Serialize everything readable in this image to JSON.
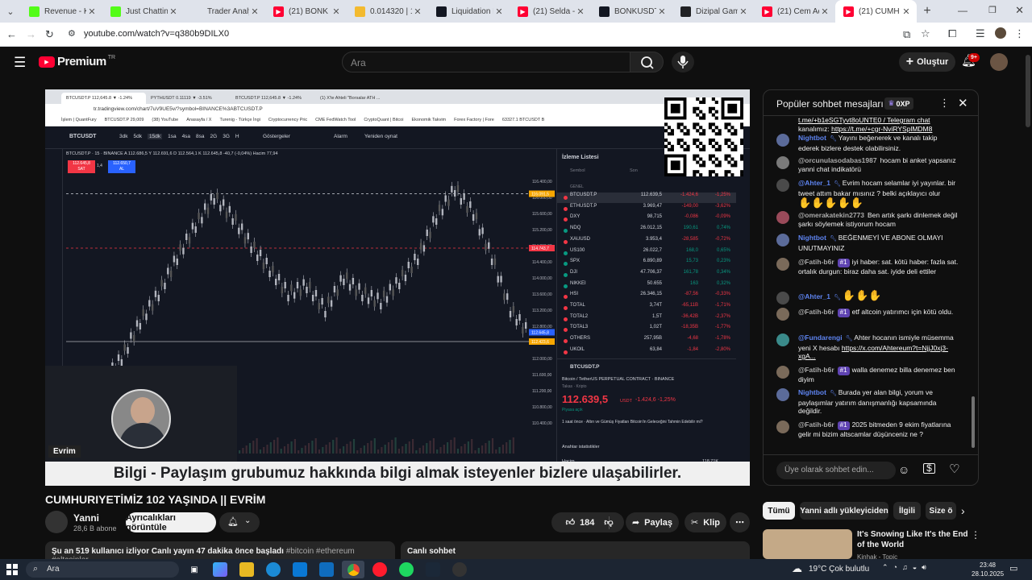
{
  "browser": {
    "tabs": [
      {
        "title": "Revenue - Kick",
        "favicon": "kick-icon",
        "color": "#53fc18",
        "active": false
      },
      {
        "title": "Just Chatting Streams",
        "favicon": "kick-icon",
        "color": "#53fc18",
        "active": false
      },
      {
        "title": "Trader Analysis",
        "favicon": "blank-icon",
        "color": "#dfe3eb",
        "active": false
      },
      {
        "title": "(21) BONK Live",
        "favicon": "youtube-icon",
        "color": "#ff0033",
        "active": false
      },
      {
        "title": "0.014320 | 100",
        "favicon": "coin-icon",
        "color": "#f3ba2f",
        "active": false
      },
      {
        "title": "Liquidation Heatmap",
        "favicon": "tradingview-icon",
        "color": "#131722",
        "active": false
      },
      {
        "title": "(21) Selda - Yo",
        "favicon": "youtube-icon",
        "color": "#ff0033",
        "active": false
      },
      {
        "title": "BONKUSDT 0.0",
        "favicon": "tradingview-icon",
        "color": "#131722",
        "active": false
      },
      {
        "title": "Dizipal Game",
        "favicon": "circle-icon",
        "color": "#202124",
        "active": false
      },
      {
        "title": "(21) Cem Adri",
        "favicon": "youtube-icon",
        "color": "#ff0033",
        "active": false
      },
      {
        "title": "(21) CUMH",
        "favicon": "youtube-icon",
        "color": "#ff0033",
        "active": true
      }
    ],
    "url": "youtube.com/watch?v=q380b9DILX0"
  },
  "yt": {
    "logo_text": "Premium",
    "logo_sup": "TR",
    "search_placeholder": "Ara",
    "create_label": "Oluştur",
    "notif_count": "9+"
  },
  "video": {
    "title": "CUMHURIYETİMİZ 102 YAŞINDA || EVRİM",
    "banner_text": "Bilgi - Paylaşım grubumuz hakkında bilgi almak isteyenler bizlere ulaşabilirler.",
    "cam_label": "Evrim",
    "inner_url": "tr.tradingview.com/chart/7uV9UE5v/?symbol=BINANCE%3ABTCUSDT.P",
    "inner_tabs": [
      "BTCUSDT.P 112,645.8 ▼ -1.24%",
      "PYTHUSDT 0.11119 ▼ -3.51%",
      "BTCUSDT.P 112,645.8 ▼ -1.24%",
      "(1) X'te Ahteli \"Borsalar ATH ..."
    ],
    "bookmarks": [
      "İşlem | QuantFury",
      "BTCUSDT.P 29,009",
      "(38) YouTube",
      "Anasayfa / X",
      "Turenig - Türkçe İngi",
      "Cryptocurrency Pric",
      "CME FedWatch Tool",
      "CryptoQuant | Bitcoi",
      "Ekonomik Takvim",
      "Forex Factory | Fore",
      "63327.1 BTCUSDT B"
    ],
    "symbol": "BTCUSDT",
    "timeframes": [
      "3dk",
      "5dk",
      "15dk",
      "1sa",
      "4sa",
      "8sa",
      "2G",
      "3G",
      "H"
    ],
    "tv_buttons": [
      "Göstergeler",
      "Alarm",
      "Yeniden oynat"
    ],
    "ohlc": "BTCUSDT.P · 15 · BINANCE  A 112.686,5  Y 112.691,6  D 112.564,1  K 112.645,8  -40,7 (-0,04%)  Hacim 77,94",
    "sell_price": "112.645,8",
    "sell_label": "SAT",
    "buy_price": "112.650,7",
    "buy_label": "AL",
    "spread": "1,4",
    "y_ticks": [
      "116.400,00",
      "116.000,00",
      "115.600,00",
      "115.200,00",
      "114.800,00",
      "114.400,00",
      "114.000,00",
      "113.600,00",
      "113.200,00",
      "112.800,00",
      "112.400,00",
      "112.000,00",
      "111.600,00",
      "111.200,00",
      "110.800,00",
      "110.400,00"
    ],
    "price_tags": [
      "116.091,5",
      "114.743,7",
      "112.645,8",
      "112.423,6"
    ],
    "x_ticks": [
      "6:00",
      "12:00",
      "18:00",
      "28",
      "06:00",
      "12:00",
      "18:00",
      "29",
      "06:00",
      "12:00",
      "18:00",
      "30"
    ],
    "time_readout": "23:48:09 (UTC+3)",
    "watchlist_title": "İzleme Listesi",
    "watchlist_headers": [
      "Sembol",
      "Son",
      "Değ",
      "Değ%"
    ],
    "watchlist_group": "GENEL",
    "watchlist": [
      {
        "sym": "BTCUSDT.P",
        "last": "112.639,5",
        "chg": "-1.424,6",
        "pct": "-1,25%"
      },
      {
        "sym": "ETHUSDT.P",
        "last": "3.969,47",
        "chg": "-149,00",
        "pct": "-3,62%"
      },
      {
        "sym": "DXY",
        "last": "98,715",
        "chg": "-0,086",
        "pct": "-0,09%"
      },
      {
        "sym": "NDQ",
        "last": "26.012,15",
        "chg": "190,61",
        "pct": "0,74%"
      },
      {
        "sym": "XAUUSD",
        "last": "3.953,4",
        "chg": "-28,585",
        "pct": "-0,72%"
      },
      {
        "sym": "US100",
        "last": "26.022,7",
        "chg": "168,0",
        "pct": "0,65%"
      },
      {
        "sym": "SPX",
        "last": "6.890,89",
        "chg": "15,73",
        "pct": "0,23%"
      },
      {
        "sym": "DJI",
        "last": "47.706,37",
        "chg": "161,78",
        "pct": "0,34%"
      },
      {
        "sym": "NIKKEI",
        "last": "50.655",
        "chg": "163",
        "pct": "0,32%"
      },
      {
        "sym": "HSI",
        "last": "26.346,15",
        "chg": "-87,56",
        "pct": "-0,33%"
      },
      {
        "sym": "TOTAL",
        "last": "3,74T",
        "chg": "-65,11B",
        "pct": "-1,71%"
      },
      {
        "sym": "TOTAL2",
        "last": "1,5T",
        "chg": "-36,42B",
        "pct": "-2,37%"
      },
      {
        "sym": "TOTAL3",
        "last": "1,02T",
        "chg": "-18,35B",
        "pct": "-1,77%"
      },
      {
        "sym": "OTHERS",
        "last": "257,95B",
        "chg": "-4,68",
        "pct": "-1,78%"
      },
      {
        "sym": "UKOIL",
        "last": "63,84",
        "chg": "-1,84",
        "pct": "-2,80%"
      }
    ],
    "detail_sym": "BTCUSDT.P",
    "detail_desc": "Bitcoin / TetherUS PERPETUAL CONTRACT · BINANCE",
    "detail_type": "Takas · Kripto",
    "detail_price": "112.639,5",
    "detail_ccy": "USDT",
    "detail_chg": "-1.424,6  -1,25%",
    "detail_status": "Piyasa açık",
    "detail_news": "1 saat önce · Altın ve Gümüş Fiyatları Bitcoin'in Geleceğini Tahmin Edebilir mi?",
    "detail_keystats": "Anahtar istatistikler",
    "detail_vol_label": "Hacim",
    "detail_vol": "118,71K"
  },
  "channel": {
    "name": "Yanni",
    "subs": "28,6 B abone",
    "join_label": "Ayrıcalıkları görüntüle"
  },
  "actions": {
    "likes": "184",
    "share": "Paylaş",
    "clip": "Klip"
  },
  "desc": {
    "stats": "Şu an 519 kullanıcı izliyor  Canlı yayın 47 dakika önce başladı",
    "tags": "#bitcoin #ethereum #altcoinler",
    "chat_label": "Canlı sohbet"
  },
  "chat": {
    "header": "Popüler sohbet mesajları",
    "xp": "0XP",
    "input_placeholder": "Üye olarak sohbet edin...",
    "messages": [
      {
        "user": "",
        "text": "kanalımız: ",
        "link": "https://t.me/+cgr-NviRYSplMDM8",
        "pre_link": "t.me/+b1eSGTyvt8oUNTE0 / Telegram chat",
        "mod": false,
        "member": "",
        "hands": 0
      },
      {
        "user": "Nightbot",
        "text": "Yayını beğenerek ve kanalı takip ederek bizlere destek olabilirsiniz.",
        "link": "",
        "pre_link": "",
        "mod": true,
        "member": "",
        "hands": 0
      },
      {
        "user": "@orcunulasodabas1987",
        "text": "hocam bi anket yapsanız yanni chat indikatörü",
        "link": "",
        "pre_link": "",
        "mod": false,
        "member": "",
        "hands": 0
      },
      {
        "user": "@Ahter_1",
        "text": "Evrim hocam selamlar iyi yayınlar. bir tweet attım bakar mısınız ? belki açıklayıcı olur",
        "link": "",
        "pre_link": "",
        "mod": true,
        "member": "",
        "hands": 5
      },
      {
        "user": "@omerakatekin2773",
        "text": "Ben artık şarkı dinlemek değil şarkı söylemek istiyorum hocam",
        "link": "",
        "pre_link": "",
        "mod": false,
        "member": "",
        "hands": 0
      },
      {
        "user": "Nightbot",
        "text": "BEĞENMEYİ VE ABONE OLMAYI UNUTMAYINIZ",
        "link": "",
        "pre_link": "",
        "mod": true,
        "member": "",
        "hands": 0
      },
      {
        "user": "@Fatih-b6r",
        "text": "iyi haber: sat. kötü haber: fazla sat. ortalık durgun: biraz daha sat. iyide deli ettiler",
        "link": "",
        "pre_link": "",
        "mod": false,
        "member": "#1",
        "hands": 0
      },
      {
        "user": "@Ahter_1",
        "text": "",
        "link": "",
        "pre_link": "",
        "mod": true,
        "member": "",
        "hands": 3
      },
      {
        "user": "@Fatih-b6r",
        "text": "etf altcoin yatırımcı için kötü oldu.",
        "link": "",
        "pre_link": "",
        "mod": false,
        "member": "#1",
        "hands": 0
      },
      {
        "user": "@Fundarengi",
        "text": "Ahter hocanın ismiyle müsemma yeni X hesabı ",
        "link": "https://x.com/Ahtereum?t=NjjJ0xj3-xgA...",
        "pre_link": "",
        "mod": true,
        "member": "",
        "hands": 0
      },
      {
        "user": "@Fatih-b6r",
        "text": "walla denemez billa denemez ben diyim",
        "link": "",
        "pre_link": "",
        "mod": false,
        "member": "#1",
        "hands": 0
      },
      {
        "user": "Nightbot",
        "text": "Burada yer alan bilgi, yorum ve paylaşımlar yatırım danışmanlığı kapsamında değildir.",
        "link": "",
        "pre_link": "",
        "mod": true,
        "member": "",
        "hands": 0
      },
      {
        "user": "@Fatih-b6r",
        "text": "2025 bitmeden 9 ekim fiyatlarına gelir mi bizim altscamlar düşünceniz ne ?",
        "link": "",
        "pre_link": "",
        "mod": false,
        "member": "#1",
        "hands": 0
      }
    ]
  },
  "chips": [
    "Tümü",
    "Yanni adlı yükleyiciden",
    "İlgili",
    "Size ö"
  ],
  "rec": {
    "title": "It's Snowing Like It's the End of the World",
    "channel": "Kinhak - Topic"
  },
  "taskbar": {
    "search": "Ara",
    "weather": "19°C  Çok bulutlu",
    "time": "23:48",
    "date": "28.10.2025"
  },
  "chart_data": {
    "type": "line",
    "title": "BTCUSDT.P",
    "xlabel": "",
    "ylabel": "",
    "x": [
      0,
      4,
      8,
      12,
      16,
      20,
      24,
      28,
      32,
      36,
      40,
      44,
      48,
      52,
      56,
      60,
      64,
      68,
      72,
      76,
      80,
      84,
      88,
      92,
      96,
      100
    ],
    "y": [
      110.4,
      110.9,
      111.4,
      112.0,
      112.9,
      113.6,
      114.5,
      115.3,
      116.0,
      115.5,
      114.8,
      114.2,
      113.6,
      113.8,
      113.2,
      114.0,
      113.6,
      113.4,
      113.9,
      114.5,
      115.5,
      116.2,
      115.6,
      114.5,
      113.2,
      112.6
    ],
    "ylim": [
      110.4,
      116.4
    ],
    "grid": false
  }
}
